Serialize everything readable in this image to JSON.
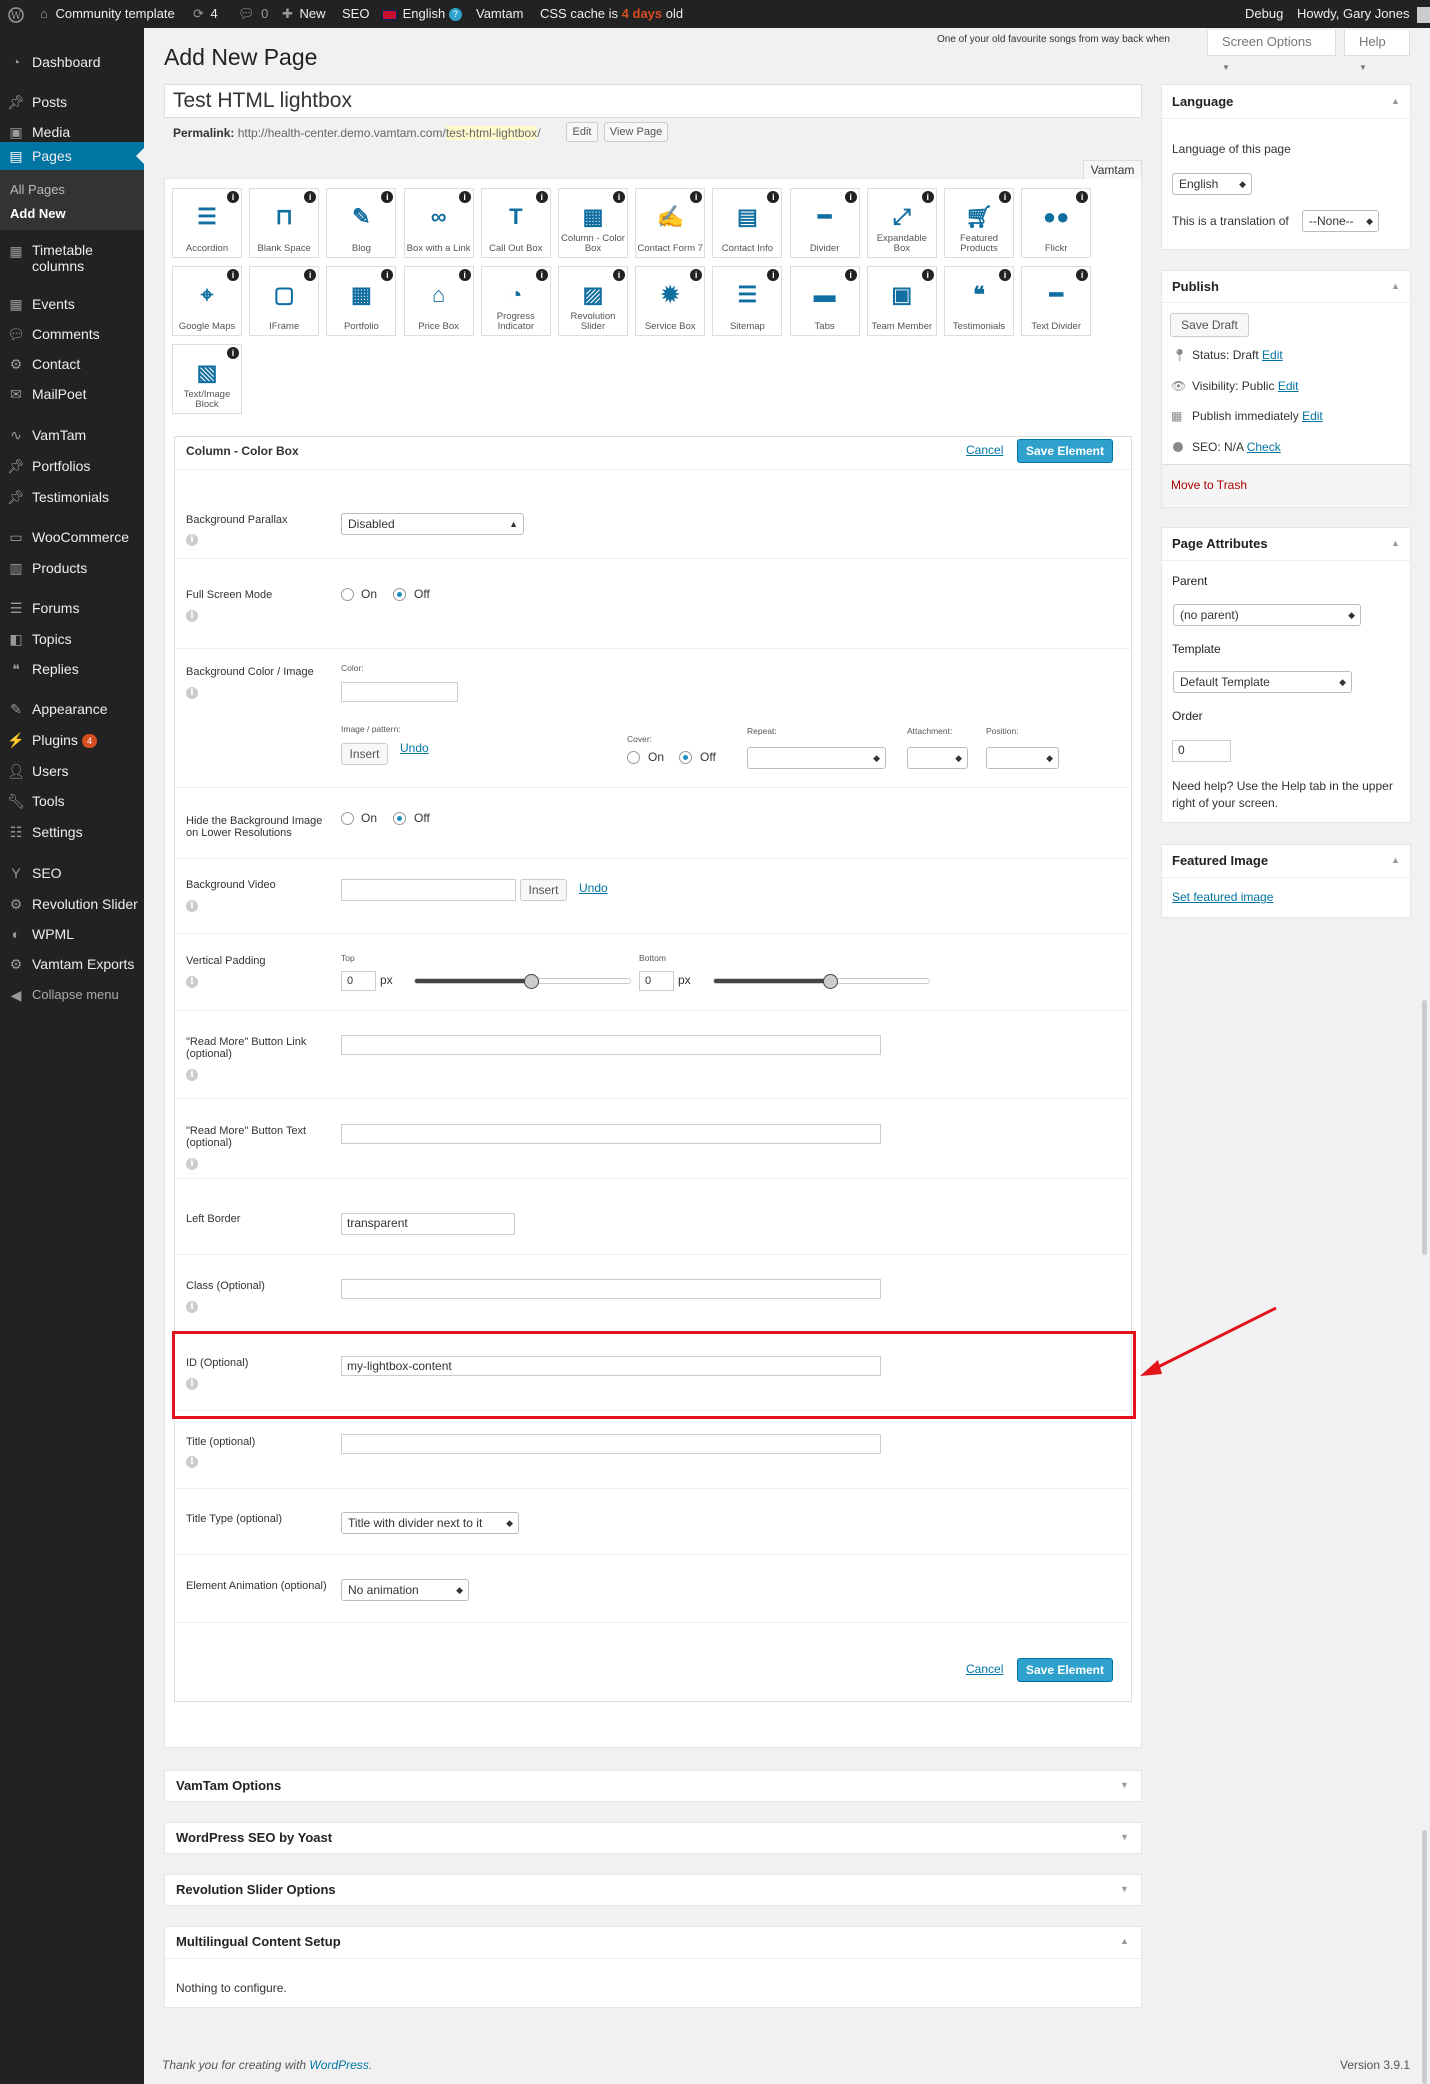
{
  "adminbar": {
    "site_name": "Community template",
    "updates_count": "4",
    "comments_count": "0",
    "new_label": "New",
    "seo_label": "SEO",
    "language": "English",
    "vamtam": "Vamtam",
    "css_cache_prefix": "CSS cache is",
    "css_cache_age": "4 days",
    "css_cache_suffix": "old",
    "debug": "Debug",
    "howdy": "Howdy, Gary Jones"
  },
  "sidebar": {
    "items": [
      {
        "label": "Dashboard",
        "icon": "dashboard-icon"
      },
      {
        "label": "Posts",
        "icon": "pin-icon"
      },
      {
        "label": "Media",
        "icon": "media-icon"
      },
      {
        "label": "Pages",
        "icon": "pages-icon"
      },
      {
        "label": "Timetable columns",
        "icon": "calendar-icon"
      },
      {
        "label": "Events",
        "icon": "calendar-icon"
      },
      {
        "label": "Comments",
        "icon": "comment-icon"
      },
      {
        "label": "Contact",
        "icon": "gear-icon"
      },
      {
        "label": "MailPoet",
        "icon": "mail-icon"
      },
      {
        "label": "VamTam",
        "icon": "vamtam-icon"
      },
      {
        "label": "Portfolios",
        "icon": "pin-icon"
      },
      {
        "label": "Testimonials",
        "icon": "pin-icon"
      },
      {
        "label": "WooCommerce",
        "icon": "woo-icon"
      },
      {
        "label": "Products",
        "icon": "products-icon"
      },
      {
        "label": "Forums",
        "icon": "forums-icon"
      },
      {
        "label": "Topics",
        "icon": "topics-icon"
      },
      {
        "label": "Replies",
        "icon": "replies-icon"
      },
      {
        "label": "Appearance",
        "icon": "brush-icon"
      },
      {
        "label": "Plugins",
        "icon": "plugin-icon",
        "badge": "4"
      },
      {
        "label": "Users",
        "icon": "user-icon"
      },
      {
        "label": "Tools",
        "icon": "wrench-icon"
      },
      {
        "label": "Settings",
        "icon": "settings-icon"
      },
      {
        "label": "SEO",
        "icon": "yoast-icon"
      },
      {
        "label": "Revolution Slider",
        "icon": "gear-icon"
      },
      {
        "label": "WPML",
        "icon": "wpml-icon"
      },
      {
        "label": "Vamtam Exports",
        "icon": "gear-icon"
      },
      {
        "label": "Collapse menu",
        "icon": "collapse-icon"
      }
    ],
    "sub_all_pages": "All Pages",
    "sub_add_new": "Add New"
  },
  "header": {
    "title": "Add New Page",
    "song": "One of your old favourite songs from way back when",
    "screen_options": "Screen Options",
    "help": "Help"
  },
  "editor": {
    "page_title": "Test HTML lightbox",
    "permalink_label": "Permalink:",
    "permalink_base": "http://health-center.demo.vamtam.com/",
    "permalink_slug": "test-html-lightbox",
    "permalink_end": "/",
    "edit_btn": "Edit",
    "view_btn": "View Page",
    "builder_tab": "Vamtam"
  },
  "elements": [
    "Accordion",
    "Blank Space",
    "Blog",
    "Box with a Link",
    "Call Out Box",
    "Column - Color Box",
    "Contact Form 7",
    "Contact Info",
    "Divider",
    "Expandable Box",
    "Featured Products",
    "Flickr",
    "Google Maps",
    "IFrame",
    "Portfolio",
    "Price Box",
    "Progress Indicator",
    "Revolution Slider",
    "Service Box",
    "Sitemap",
    "Tabs",
    "Team Member",
    "Testimonials",
    "Text Divider",
    "Text/Image Block"
  ],
  "form": {
    "title": "Column - Color Box",
    "cancel": "Cancel",
    "save": "Save Element",
    "bg_parallax_label": "Background Parallax",
    "bg_parallax_value": "Disabled",
    "fullscreen_label": "Full Screen Mode",
    "on": "On",
    "off": "Off",
    "bg_color_label": "Background Color / Image",
    "color_label": "Color:",
    "image_pattern_label": "Image / pattern:",
    "insert": "Insert",
    "undo": "Undo",
    "cover_label": "Cover:",
    "repeat_label": "Repeat:",
    "attachment_label": "Attachment:",
    "position_label": "Position:",
    "hide_bg_label": "Hide the Background Image on Lower Resolutions",
    "bg_video_label": "Background Video",
    "vpad_label": "Vertical Padding",
    "top_label": "Top",
    "bottom_label": "Bottom",
    "top_value": "0",
    "bottom_value": "0",
    "px": "px",
    "top_slider_level": 0.54,
    "bottom_slider_level": 0.54,
    "readmore_link_label": "\"Read More\" Button Link (optional)",
    "readmore_text_label": "\"Read More\" Button Text (optional)",
    "left_border_label": "Left Border",
    "left_border_value": "transparent",
    "class_label": "Class (Optional)",
    "id_label": "ID (Optional)",
    "id_value": "my-lightbox-content",
    "title_label": "Title (optional)",
    "title_type_label": "Title Type (optional)",
    "title_type_value": "Title with divider next to it",
    "animation_label": "Element Animation (optional)",
    "animation_value": "No animation",
    "highlight_color": "#e3131b"
  },
  "metaboxes": {
    "vamtam_options": "VamTam Options",
    "yoast": "WordPress SEO by Yoast",
    "revslider": "Revolution Slider Options",
    "multilingual": "Multilingual Content Setup",
    "nothing": "Nothing to configure."
  },
  "right": {
    "language_title": "Language",
    "language_of_page": "Language of this page",
    "language_value": "English",
    "translation_of": "This is a translation of",
    "translation_value": "--None--",
    "publish_title": "Publish",
    "save_draft": "Save Draft",
    "status": "Status: Draft",
    "visibility": "Visibility: Public",
    "publish_immediately": "Publish immediately",
    "seo": "SEO: N/A",
    "edit": "Edit",
    "check": "Check",
    "move_to_trash": "Move to Trash",
    "attributes_title": "Page Attributes",
    "parent_label": "Parent",
    "parent_value": "(no parent)",
    "template_label": "Template",
    "template_value": "Default Template",
    "order_label": "Order",
    "order_value": "0",
    "help_text_1": "Need help? Use the Help tab in the upper",
    "help_text_2": "right of your screen.",
    "featured_title": "Featured Image",
    "set_featured": "Set featured image"
  },
  "footer": {
    "thanks_prefix": "Thank you for creating with",
    "wordpress": "WordPress",
    "thanks_suffix": ".",
    "version": "Version 3.9.1"
  }
}
